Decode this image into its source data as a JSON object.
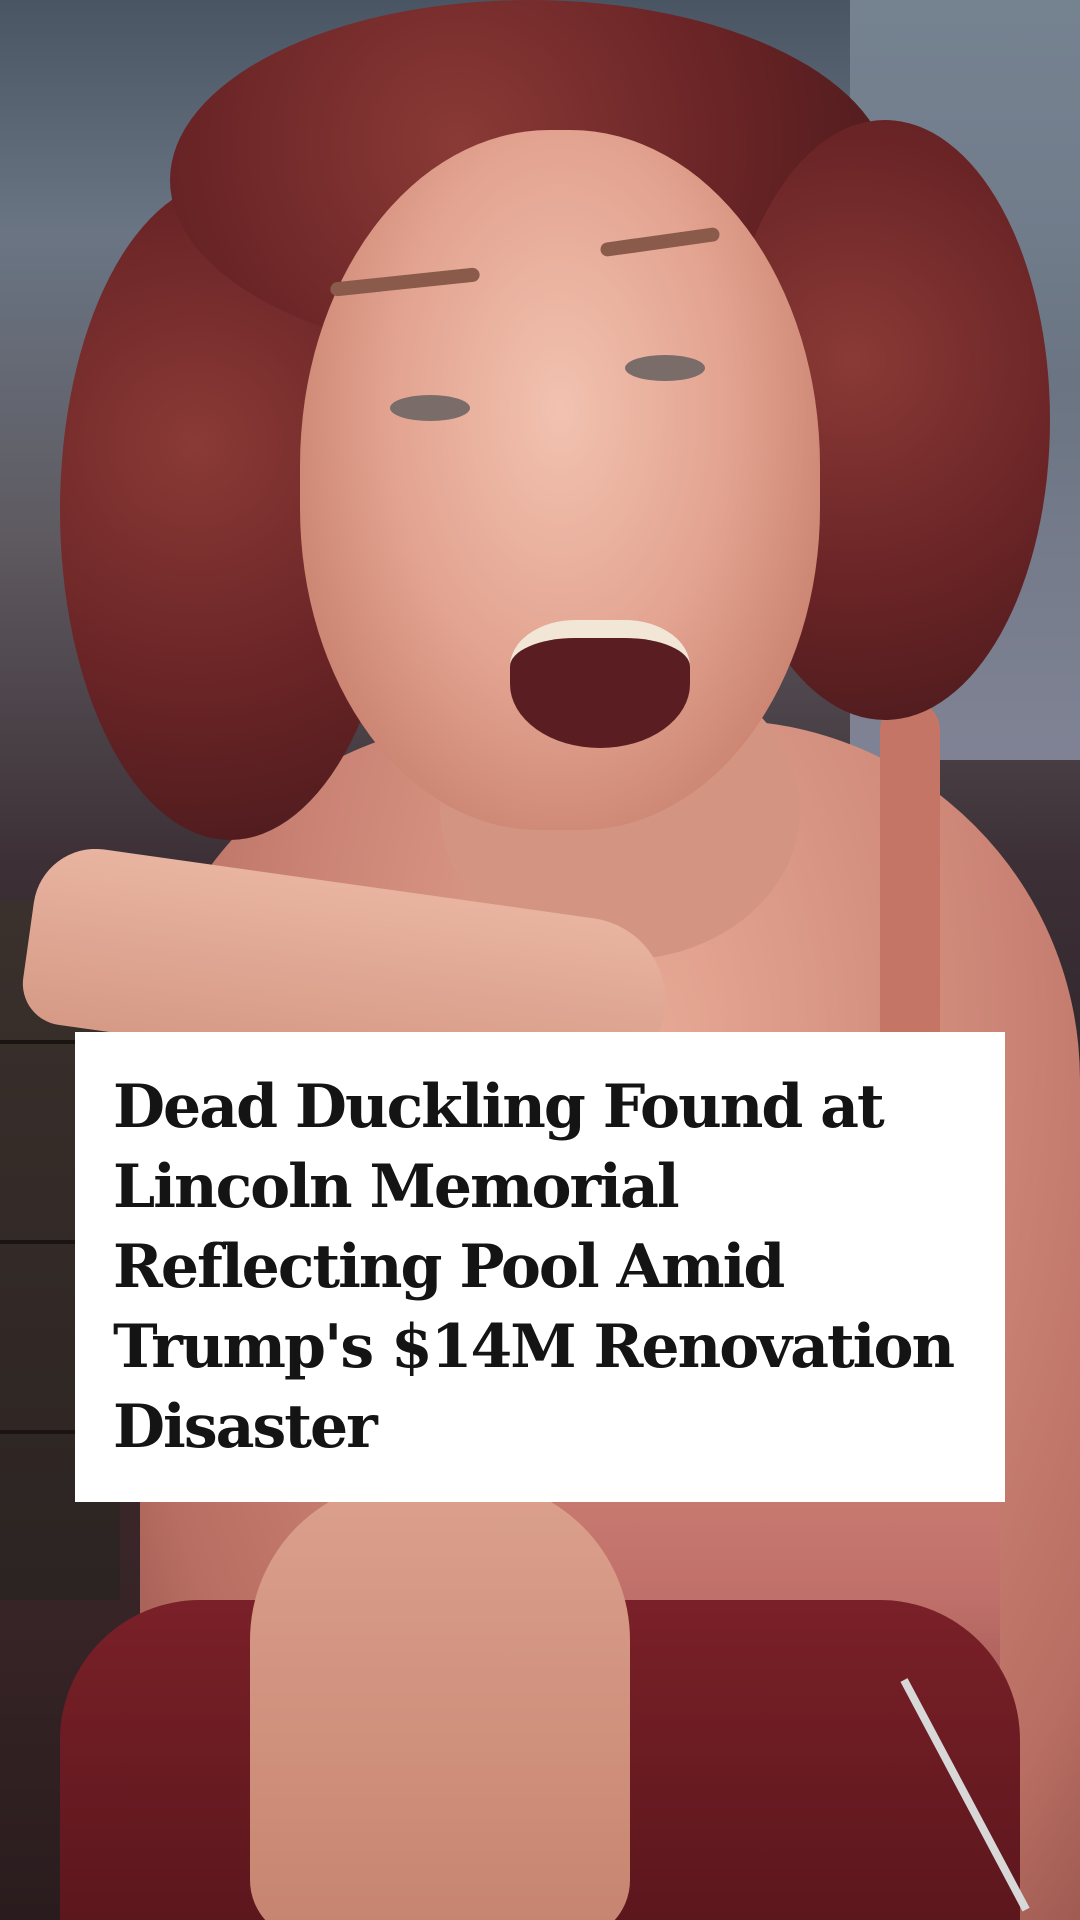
{
  "video": {
    "scene": "person-speaking-to-camera"
  },
  "headline": {
    "text": "Dead Duckling Found at Lincoln Memorial Reflecting Pool Amid Trump's $14M Renovation Disaster"
  },
  "colors": {
    "card_background": "#ffffff",
    "headline_text": "#141414"
  }
}
